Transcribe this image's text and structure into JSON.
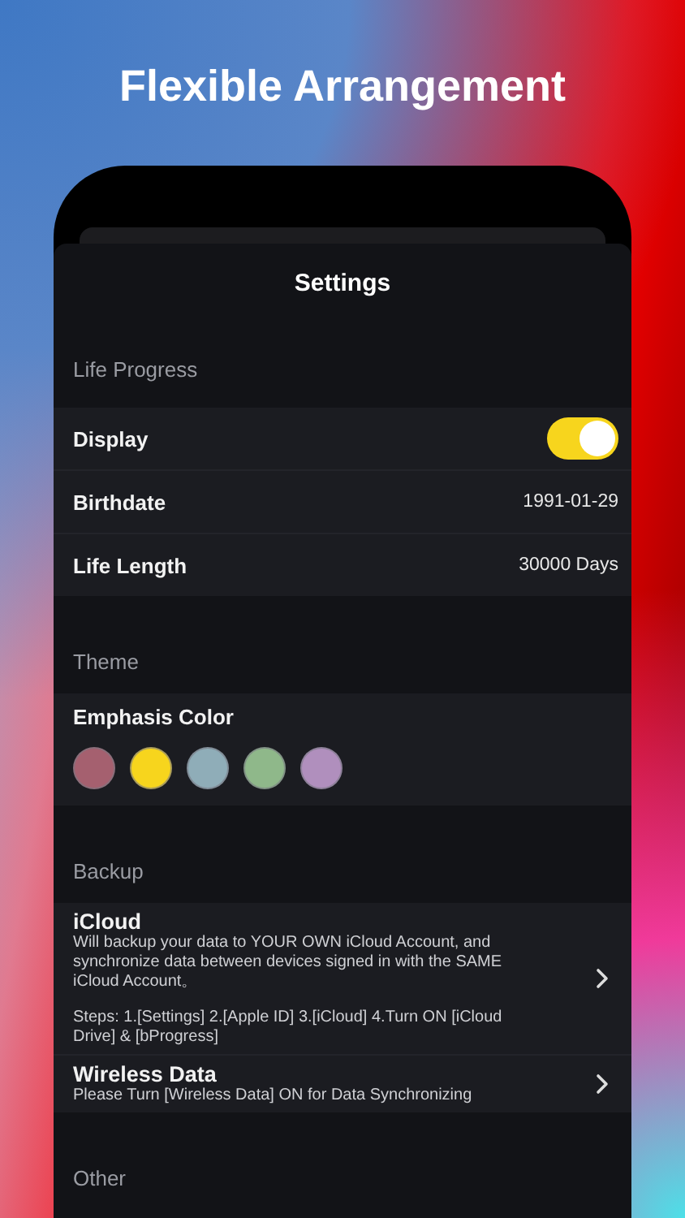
{
  "headline": "Flexible Arrangement",
  "screen_title": "Settings",
  "sections": [
    {
      "header": "Life Progress",
      "kind": "rows",
      "rows": [
        {
          "kind": "toggle",
          "label": "Display",
          "on": true
        },
        {
          "kind": "value",
          "label": "Birthdate",
          "value": "1991-01-29"
        },
        {
          "kind": "value",
          "label": "Life Length",
          "value": "30000 Days"
        }
      ]
    },
    {
      "header": "Theme",
      "kind": "colors",
      "label": "Emphasis Color",
      "colors": [
        {
          "color": "#a5606f"
        },
        {
          "color": "#f7d51d"
        },
        {
          "color": "#8fadb8"
        },
        {
          "color": "#8fb88a"
        },
        {
          "color": "#b08fbd"
        }
      ]
    },
    {
      "header": "Backup",
      "kind": "rows",
      "rows": [
        {
          "kind": "link",
          "label": "iCloud",
          "description": "Will backup your data to YOUR OWN iCloud Account, and synchronize data between devices signed in with the SAME iCloud Account。",
          "note": "Steps: 1.[Settings] 2.[Apple ID] 3.[iCloud] 4.Turn ON [iCloud Drive] & [bProgress]"
        },
        {
          "kind": "link",
          "label": "Wireless Data",
          "description": "Please Turn [Wireless Data] ON for Data Synchronizing"
        }
      ]
    },
    {
      "header": "Other",
      "kind": "header"
    }
  ]
}
